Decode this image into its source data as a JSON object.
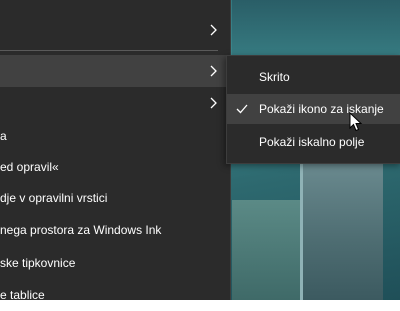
{
  "context_menu": {
    "items": [
      {
        "label": "",
        "has_submenu": true
      },
      {
        "label": "",
        "has_submenu": true,
        "highlighted": true
      },
      {
        "label": "",
        "has_submenu": true
      },
      {
        "label": "a",
        "has_submenu": false
      },
      {
        "label": "ed opravil«",
        "has_submenu": false
      },
      {
        "label": "dje v opravilni vrstici",
        "has_submenu": false
      },
      {
        "label": "nega prostora za Windows Ink",
        "has_submenu": false
      },
      {
        "label": "ske tipkovnice",
        "has_submenu": false
      },
      {
        "label": "e tablice",
        "has_submenu": false
      }
    ]
  },
  "submenu": {
    "items": [
      {
        "label": "Skrito",
        "checked": false
      },
      {
        "label": "Pokaži ikono za iskanje",
        "checked": true
      },
      {
        "label": "Pokaži iskalno polje",
        "checked": false
      }
    ]
  },
  "icons": {
    "chevron": "chevron-right-icon",
    "check": "checkmark-icon",
    "cursor": "mouse-pointer-icon"
  },
  "colors": {
    "menu_bg": "#2b2b2b",
    "hover_bg": "#414141",
    "text": "#ffffff"
  }
}
